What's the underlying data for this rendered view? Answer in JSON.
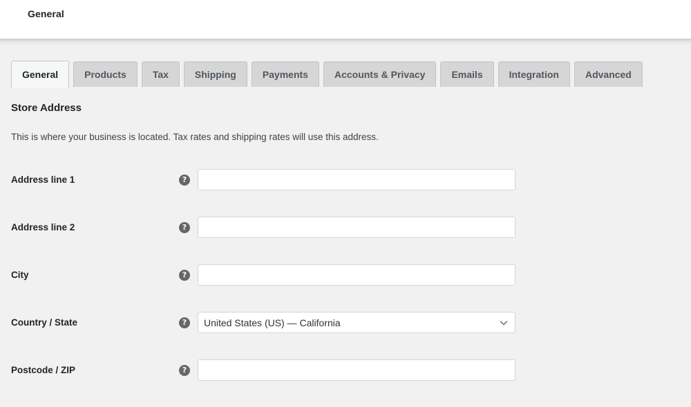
{
  "header": {
    "title": "General"
  },
  "tabs": [
    {
      "label": "General",
      "name": "tab-general",
      "active": true
    },
    {
      "label": "Products",
      "name": "tab-products",
      "active": false
    },
    {
      "label": "Tax",
      "name": "tab-tax",
      "active": false
    },
    {
      "label": "Shipping",
      "name": "tab-shipping",
      "active": false
    },
    {
      "label": "Payments",
      "name": "tab-payments",
      "active": false
    },
    {
      "label": "Accounts & Privacy",
      "name": "tab-accounts-privacy",
      "active": false
    },
    {
      "label": "Emails",
      "name": "tab-emails",
      "active": false
    },
    {
      "label": "Integration",
      "name": "tab-integration",
      "active": false
    },
    {
      "label": "Advanced",
      "name": "tab-advanced",
      "active": false
    }
  ],
  "section": {
    "title": "Store Address",
    "description": "This is where your business is located. Tax rates and shipping rates will use this address."
  },
  "help_icon": {
    "glyph": "?",
    "semantic": "help-tip-icon"
  },
  "chevron_icon": {
    "semantic": "chevron-down-icon"
  },
  "fields": [
    {
      "label": "Address line 1",
      "name": "address-line-1",
      "type": "text",
      "value": "",
      "placeholder": ""
    },
    {
      "label": "Address line 2",
      "name": "address-line-2",
      "type": "text",
      "value": "",
      "placeholder": ""
    },
    {
      "label": "City",
      "name": "city",
      "type": "text",
      "value": "",
      "placeholder": ""
    },
    {
      "label": "Country / State",
      "name": "country-state",
      "type": "select",
      "value": "United States (US) — California",
      "placeholder": ""
    },
    {
      "label": "Postcode / ZIP",
      "name": "postcode-zip",
      "type": "text",
      "value": "",
      "placeholder": ""
    }
  ],
  "colors": {
    "page_background": "#f1f1f1",
    "header_background": "#ffffff",
    "tab_inactive": "#d6d6d6",
    "tab_active": "#f6f7f7",
    "tab_border": "#c3c4c7",
    "input_border": "#d2d4d7",
    "text_primary": "#1d2327",
    "text_secondary": "#3c434a",
    "help_icon_background": "#666666"
  }
}
